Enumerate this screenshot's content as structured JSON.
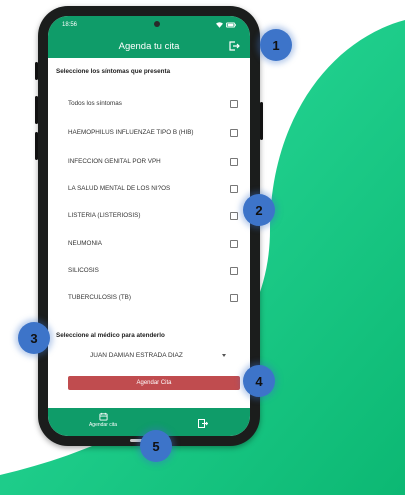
{
  "status_bar": {
    "time": "18:56"
  },
  "app_bar": {
    "title": "Agenda tu cita"
  },
  "symptoms": {
    "heading": "Seleccione los síntomas que presenta",
    "items": [
      {
        "label": "Todos los síntomas"
      },
      {
        "label": "HAEMOPHILUS INFLUENZAE TIPO B (HIB)"
      },
      {
        "label": "INFECCION GENITAL POR VPH"
      },
      {
        "label": "LA SALUD MENTAL DE LOS NI?OS"
      },
      {
        "label": "LISTERIA (LISTERIOSIS)"
      },
      {
        "label": "NEUMONIA"
      },
      {
        "label": "SILICOSIS"
      },
      {
        "label": "TUBERCULOSIS (TB)"
      }
    ]
  },
  "doctor": {
    "heading": "Seleccione al médico para atenderlo",
    "selected": "JUAN DAMIAN ESTRADA DIAZ"
  },
  "submit_label": "Agendar Cita",
  "bottom_nav": {
    "agendar_label": "Agendar cita"
  },
  "markers": [
    "1",
    "2",
    "3",
    "4",
    "5"
  ],
  "colors": {
    "primary": "#0f9c69",
    "accent_button": "#c04c4f",
    "marker": "#3d74c9"
  },
  "icons": {
    "logout": "logout-icon",
    "calendar": "calendar-icon",
    "exit": "exit-icon",
    "dropdown": "chevron-down-icon"
  }
}
